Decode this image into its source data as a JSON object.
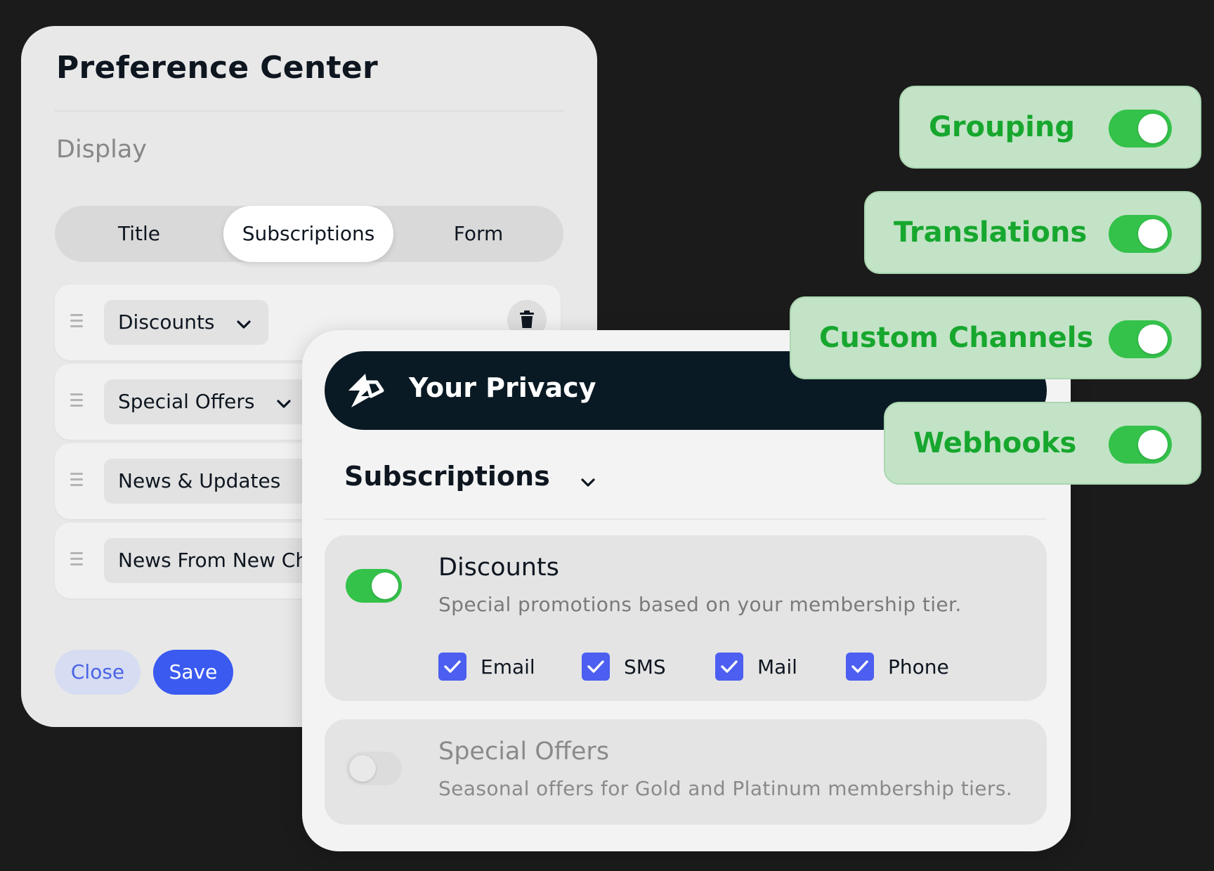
{
  "preference_center": {
    "title": "Preference Center",
    "section_label": "Display",
    "tabs": [
      {
        "label": "Title",
        "active": false
      },
      {
        "label": "Subscriptions",
        "active": true
      },
      {
        "label": "Form",
        "active": false
      }
    ],
    "rows": [
      {
        "label": "Discounts"
      },
      {
        "label": "Special Offers"
      },
      {
        "label": "News & Updates"
      },
      {
        "label": "News From New Ch"
      }
    ],
    "close_label": "Close",
    "save_label": "Save"
  },
  "privacy": {
    "title": "Your Privacy",
    "section_title": "Subscriptions",
    "items": [
      {
        "name": "Discounts",
        "description": "Special promotions based on your membership tier.",
        "enabled": true,
        "channels": [
          {
            "label": "Email",
            "checked": true
          },
          {
            "label": "SMS",
            "checked": true
          },
          {
            "label": "Mail",
            "checked": true
          },
          {
            "label": "Phone",
            "checked": true
          }
        ]
      },
      {
        "name": "Special Offers",
        "description": "Seasonal offers for Gold and Platinum membership tiers.",
        "enabled": false
      }
    ]
  },
  "features": [
    {
      "label": "Grouping",
      "enabled": true
    },
    {
      "label": "Translations",
      "enabled": true
    },
    {
      "label": "Custom Channels",
      "enabled": true
    },
    {
      "label": "Webhooks",
      "enabled": true
    }
  ],
  "colors": {
    "accent_blue": "#3a5af0",
    "toggle_green": "#34c24a",
    "feature_text_green": "#17a72e",
    "privacy_bar": "#0a1a24"
  }
}
